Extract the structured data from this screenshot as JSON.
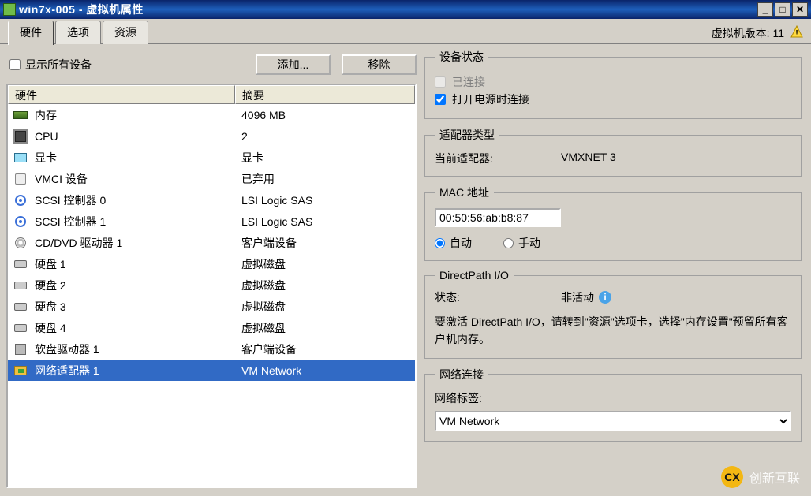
{
  "window_title": "win7x-005 - 虚拟机属性",
  "tabs": {
    "hardware": "硬件",
    "options": "选项",
    "resources": "资源"
  },
  "vm_version_label": "虚拟机版本: 11",
  "left": {
    "show_all_devices": "显示所有设备",
    "add_button": "添加...",
    "remove_button": "移除",
    "col_hardware": "硬件",
    "col_summary": "摘要",
    "rows": [
      {
        "icon": "memory",
        "name": "内存",
        "summary": "4096 MB"
      },
      {
        "icon": "cpu",
        "name": "CPU",
        "summary": "2"
      },
      {
        "icon": "video",
        "name": "显卡",
        "summary": "显卡"
      },
      {
        "icon": "vmci",
        "name": "VMCI 设备",
        "summary": "已弃用"
      },
      {
        "icon": "scsi",
        "name": "SCSI 控制器 0",
        "summary": "LSI Logic SAS"
      },
      {
        "icon": "scsi",
        "name": "SCSI 控制器 1",
        "summary": "LSI Logic SAS"
      },
      {
        "icon": "cd",
        "name": "CD/DVD 驱动器 1",
        "summary": "客户端设备"
      },
      {
        "icon": "disk",
        "name": "硬盘 1",
        "summary": "虚拟磁盘"
      },
      {
        "icon": "disk",
        "name": "硬盘 2",
        "summary": "虚拟磁盘"
      },
      {
        "icon": "disk",
        "name": "硬盘 3",
        "summary": "虚拟磁盘"
      },
      {
        "icon": "disk",
        "name": "硬盘 4",
        "summary": "虚拟磁盘"
      },
      {
        "icon": "floppy",
        "name": "软盘驱动器 1",
        "summary": "客户端设备"
      },
      {
        "icon": "net",
        "name": "网络适配器 1",
        "summary": "VM Network"
      }
    ]
  },
  "right": {
    "device_status": {
      "legend": "设备状态",
      "connected": "已连接",
      "connect_on_power": "打开电源时连接"
    },
    "adapter_type": {
      "legend": "适配器类型",
      "current_label": "当前适配器:",
      "current_value": "VMXNET 3"
    },
    "mac": {
      "legend": "MAC 地址",
      "value": "00:50:56:ab:b8:87",
      "auto": "自动",
      "manual": "手动"
    },
    "directpath": {
      "legend": "DirectPath I/O",
      "status_label": "状态:",
      "status_value": "非活动",
      "note": "要激活 DirectPath I/O，请转到\"资源\"选项卡，选择\"内存设置\"预留所有客户机内存。"
    },
    "netconn": {
      "legend": "网络连接",
      "label": "网络标签:",
      "value": "VM Network"
    }
  },
  "watermark": "创新互联"
}
